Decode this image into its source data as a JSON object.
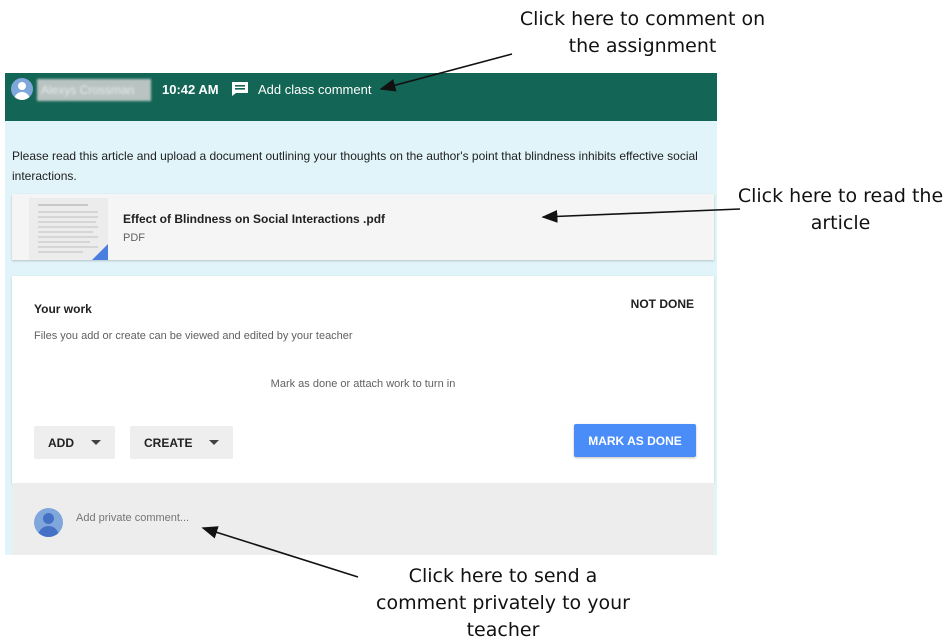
{
  "annotations": {
    "top": "Click here to comment on\nthe assignment",
    "right": "Click here to read the\narticle",
    "bottom": "Click here to send a\ncomment privately to your\nteacher"
  },
  "header": {
    "author_name": "Alexys Crossman",
    "time": "10:42 AM",
    "class_comment_label": "Add class comment"
  },
  "assignment": {
    "instructions": "Please read this article and upload a document outlining your thoughts on the author's point that blindness inhibits effective social interactions."
  },
  "attachment": {
    "file_name": "Effect of Blindness on Social Interactions .pdf",
    "file_type": "PDF"
  },
  "your_work": {
    "title": "Your work",
    "status": "NOT DONE",
    "hint": "Files you add or create can be viewed and edited by your teacher",
    "center_hint": "Mark as done or attach work to turn in",
    "add_label": "ADD",
    "create_label": "CREATE",
    "mark_done_label": "MARK AS DONE"
  },
  "private_comment": {
    "placeholder": "Add private comment..."
  },
  "colors": {
    "header_bg": "#136655",
    "frame_bg": "#e0f4fa",
    "accent_button": "#4b8df8"
  },
  "icons": {
    "user_avatar": "user-avatar-icon",
    "comment": "comment-icon",
    "dropdown": "chevron-down-icon",
    "pdf_badge": "pdf-corner-icon"
  }
}
